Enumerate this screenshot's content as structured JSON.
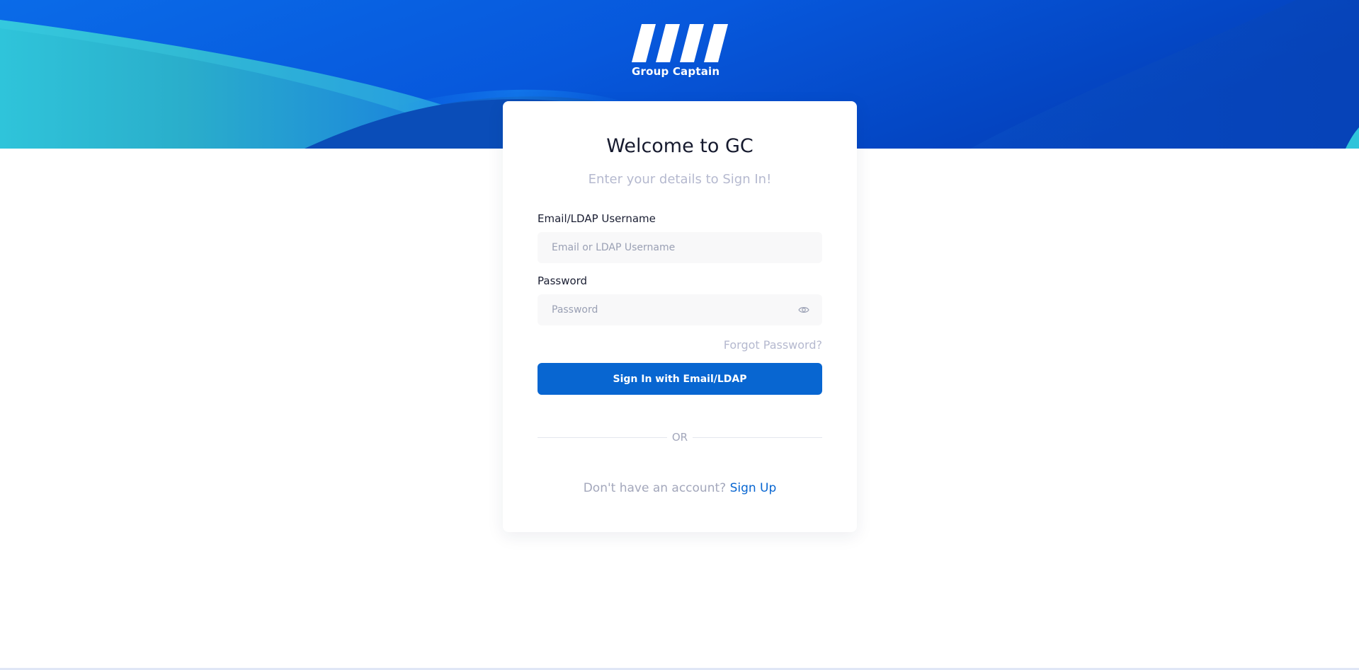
{
  "brand": {
    "name": "Group Captain",
    "logo_icon": "four-slanted-bars-logo-icon"
  },
  "colors": {
    "primary": "#0866d1",
    "hero_blue": "#0a5fe0",
    "hero_cyan": "#30c7d8",
    "muted_text": "#b5b9cf"
  },
  "card": {
    "title": "Welcome to GC",
    "subtitle": "Enter your details to Sign In!"
  },
  "form": {
    "email_label": "Email/LDAP Username",
    "email_placeholder": "Email or LDAP Username",
    "email_value": "",
    "password_label": "Password",
    "password_placeholder": "Password",
    "password_value": "",
    "password_toggle_icon": "eye-icon",
    "forgot_password": "Forgot Password?",
    "submit_label": "Sign In with Email/LDAP"
  },
  "divider": {
    "text": "OR"
  },
  "signup": {
    "prompt": "Don't have an account?",
    "link": "Sign Up"
  }
}
